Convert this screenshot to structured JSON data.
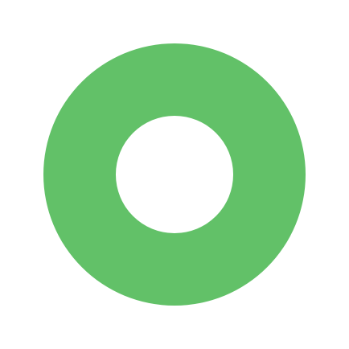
{
  "icon": {
    "name": "ring-icon",
    "shape": "ring",
    "color": "#62c168",
    "background": "#ffffff"
  }
}
